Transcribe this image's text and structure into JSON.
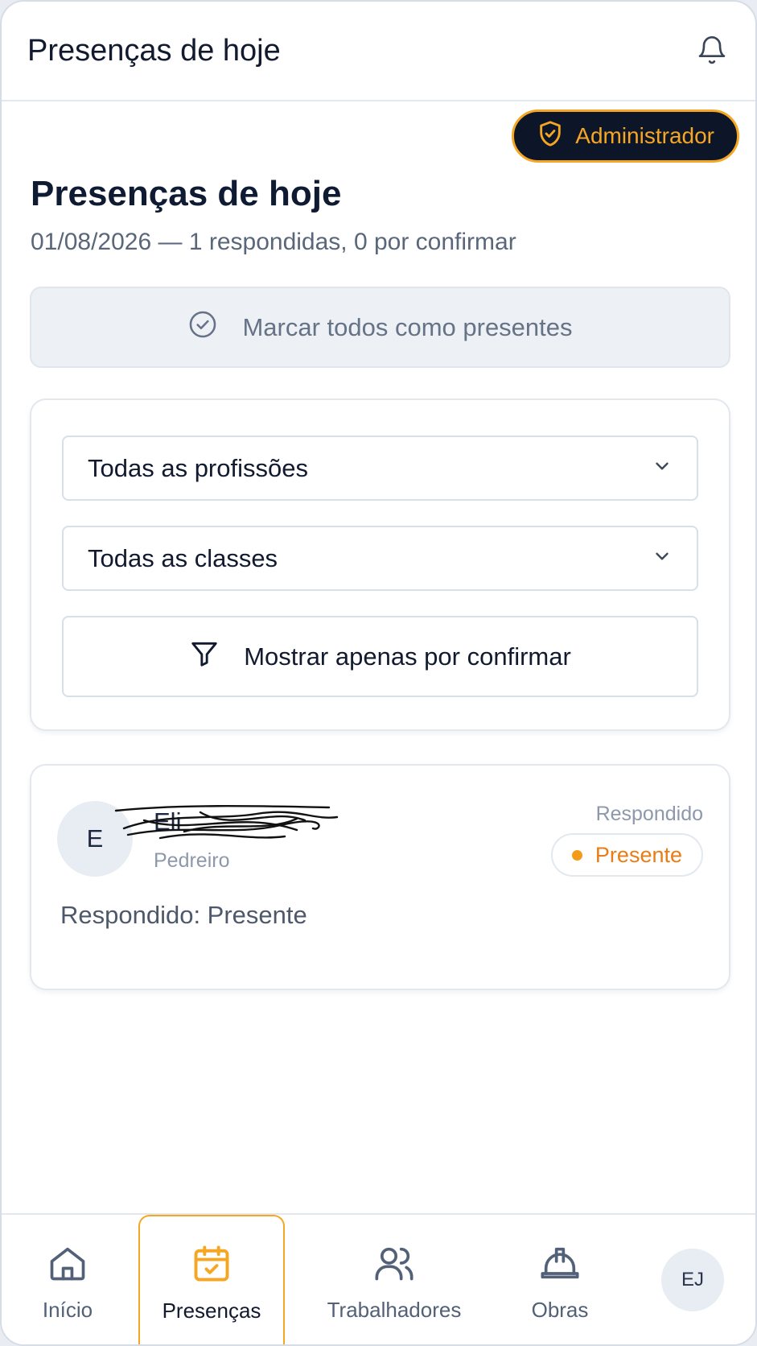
{
  "header": {
    "title": "Presenças de hoje",
    "notification_icon": "bell-icon"
  },
  "role_badge": {
    "label": "Administrador",
    "icon": "shield-check-icon",
    "color": "#f5a623"
  },
  "page": {
    "heading": "Presenças de hoje",
    "subheading": "01/08/2026 — 1 respondidas, 0 por confirmar"
  },
  "actions": {
    "mark_all_label": "Marcar todos como presentes",
    "mark_all_icon": "check-circle-icon"
  },
  "filters": {
    "profession_select": "Todas as profissões",
    "class_select": "Todas as classes",
    "pending_only_label": "Mostrar apenas por confirmar",
    "pending_only_icon": "filter-icon"
  },
  "workers": [
    {
      "initial": "E",
      "name": "Eli",
      "role": "Pedreiro",
      "response_label": "Respondido",
      "status": "Presente",
      "status_color": "#f39c19",
      "note": "Respondido: Presente"
    }
  ],
  "nav": {
    "items": [
      {
        "label": "Início",
        "icon": "home-icon"
      },
      {
        "label": "Presenças",
        "icon": "calendar-check-icon",
        "active": true
      },
      {
        "label": "Trabalhadores",
        "icon": "users-icon"
      },
      {
        "label": "Obras",
        "icon": "hard-hat-icon"
      }
    ],
    "user_initials": "EJ",
    "accent_color": "#f5a623"
  }
}
